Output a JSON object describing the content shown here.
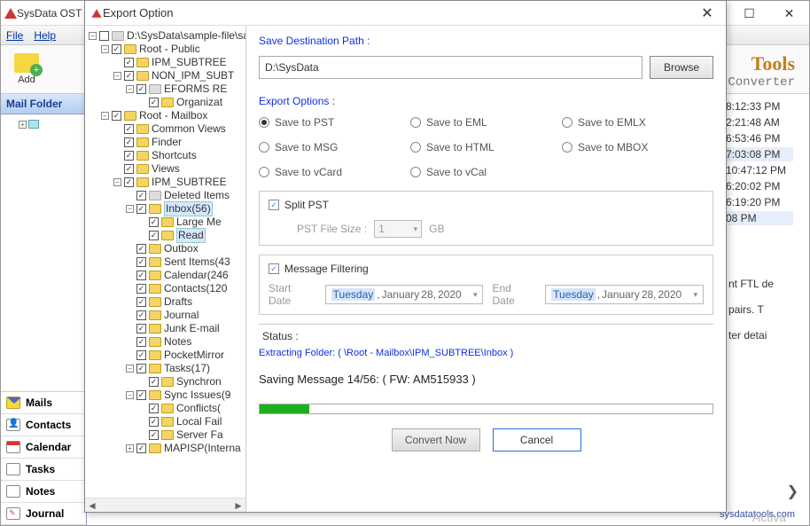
{
  "bg": {
    "title": "SysData OST",
    "menu": {
      "file": "File",
      "help": "Help"
    },
    "toolbar": {
      "add": "Add"
    },
    "sidebar": {
      "header": "Mail Folder",
      "nav": {
        "mails": "Mails",
        "contacts": "Contacts",
        "calendar": "Calendar",
        "tasks": "Tasks",
        "notes": "Notes",
        "journal": "Journal"
      }
    },
    "brand": "Tools",
    "brand_sub": "Converter",
    "times": [
      "8:12:33 PM",
      "2:21:48 AM",
      "6:53:46 PM",
      "7:03:08 PM",
      "10:47:12 PM",
      "6:20:02 PM",
      "6:19:20 PM",
      "08 PM"
    ],
    "snips": [
      "nt FTL de",
      "pairs.  T",
      "ter detai"
    ],
    "status": "sysdatatools.com",
    "activa": "Activa"
  },
  "dialog": {
    "title": "Export Option",
    "tree": [
      {
        "d": 1,
        "exp": "-",
        "ck": false,
        "gry": true,
        "label": "D:\\SysData\\sample-file\\sa"
      },
      {
        "d": 2,
        "exp": "-",
        "ck": true,
        "label": "Root - Public"
      },
      {
        "d": 3,
        "exp": "",
        "ck": true,
        "label": "IPM_SUBTREE"
      },
      {
        "d": 3,
        "exp": "-",
        "ck": true,
        "label": "NON_IPM_SUBT"
      },
      {
        "d": 4,
        "exp": "-",
        "ck": true,
        "gry": true,
        "label": "EFORMS RE"
      },
      {
        "d": 5,
        "exp": "",
        "ck": true,
        "label": "Organizat"
      },
      {
        "d": 2,
        "exp": "-",
        "ck": true,
        "label": "Root - Mailbox"
      },
      {
        "d": 3,
        "exp": "",
        "ck": true,
        "label": "Common Views"
      },
      {
        "d": 3,
        "exp": "",
        "ck": true,
        "label": "Finder"
      },
      {
        "d": 3,
        "exp": "",
        "ck": true,
        "label": "Shortcuts"
      },
      {
        "d": 3,
        "exp": "",
        "ck": true,
        "label": "Views"
      },
      {
        "d": 3,
        "exp": "-",
        "ck": true,
        "label": "IPM_SUBTREE"
      },
      {
        "d": 4,
        "exp": "",
        "ck": true,
        "gry": true,
        "label": "Deleted Items"
      },
      {
        "d": 4,
        "exp": "-",
        "ck": true,
        "label": "Inbox(56)",
        "sel": true
      },
      {
        "d": 5,
        "exp": "",
        "ck": true,
        "label": "Large Me"
      },
      {
        "d": 5,
        "exp": "",
        "ck": true,
        "label": "Read",
        "sel": true
      },
      {
        "d": 4,
        "exp": "",
        "ck": true,
        "label": "Outbox"
      },
      {
        "d": 4,
        "exp": "",
        "ck": true,
        "label": "Sent Items(43"
      },
      {
        "d": 4,
        "exp": "",
        "ck": true,
        "label": "Calendar(246"
      },
      {
        "d": 4,
        "exp": "",
        "ck": true,
        "label": "Contacts(120"
      },
      {
        "d": 4,
        "exp": "",
        "ck": true,
        "label": "Drafts"
      },
      {
        "d": 4,
        "exp": "",
        "ck": true,
        "label": "Journal"
      },
      {
        "d": 4,
        "exp": "",
        "ck": true,
        "label": "Junk E-mail"
      },
      {
        "d": 4,
        "exp": "",
        "ck": true,
        "label": "Notes"
      },
      {
        "d": 4,
        "exp": "",
        "ck": true,
        "label": "PocketMirror"
      },
      {
        "d": 4,
        "exp": "-",
        "ck": true,
        "label": "Tasks(17)"
      },
      {
        "d": 5,
        "exp": "",
        "ck": true,
        "label": "Synchron"
      },
      {
        "d": 4,
        "exp": "-",
        "ck": true,
        "label": "Sync Issues(9"
      },
      {
        "d": 5,
        "exp": "",
        "ck": true,
        "label": "Conflicts("
      },
      {
        "d": 5,
        "exp": "",
        "ck": true,
        "label": "Local Fail"
      },
      {
        "d": 5,
        "exp": "",
        "ck": true,
        "label": "Server Fa"
      },
      {
        "d": 4,
        "exp": "+",
        "ck": true,
        "label": "MAPISP(Interna"
      }
    ],
    "save_path": {
      "label": "Save Destination Path :",
      "value": "D:\\SysData",
      "browse": "Browse"
    },
    "export_options": {
      "label": "Export Options :",
      "opts": [
        {
          "label": "Save to PST",
          "on": true
        },
        {
          "label": "Save to EML",
          "on": false
        },
        {
          "label": "Save to EMLX",
          "on": false
        },
        {
          "label": "Save to MSG",
          "on": false
        },
        {
          "label": "Save to HTML",
          "on": false
        },
        {
          "label": "Save to MBOX",
          "on": false
        },
        {
          "label": "Save to vCard",
          "on": false
        },
        {
          "label": "Save to vCal",
          "on": false
        }
      ]
    },
    "split": {
      "label": "Split PST",
      "size_label": "PST File Size :",
      "size_value": "1",
      "unit": "GB"
    },
    "filter": {
      "label": "Message Filtering",
      "start_label": "Start Date",
      "start_value": {
        "dow": "Tuesday",
        "m": "January",
        "d": "28,",
        "y": "2020"
      },
      "end_label": "End Date",
      "end_value": {
        "dow": "Tuesday",
        "m": "January",
        "d": "28,",
        "y": "2020"
      }
    },
    "status": {
      "label": "Status :",
      "extracting": "Extracting Folder: ( \\Root - Mailbox\\IPM_SUBTREE\\Inbox )",
      "saving": "Saving Message 14/56: ( FW: AM515933 )",
      "progress_pct": 11
    },
    "buttons": {
      "convert": "Convert Now",
      "cancel": "Cancel"
    }
  }
}
